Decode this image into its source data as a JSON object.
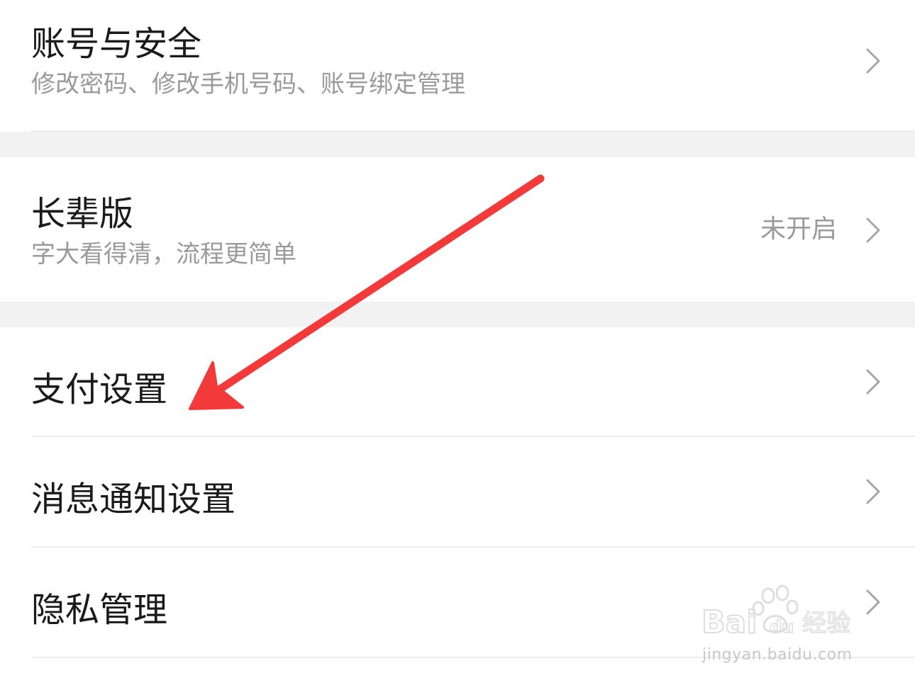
{
  "settings": {
    "account": {
      "title": "账号与安全",
      "subtitle": "修改密码、修改手机号码、账号绑定管理"
    },
    "elder_mode": {
      "title": "长辈版",
      "subtitle": "字大看得清，流程更简单",
      "status": "未开启"
    },
    "payment": {
      "title": "支付设置"
    },
    "notifications": {
      "title": "消息通知设置"
    },
    "privacy": {
      "title": "隐私管理"
    }
  },
  "annotation": {
    "arrow_color": "#f23a3a"
  },
  "watermark": {
    "brand": "Baidu经验",
    "url": "jingyan.baidu.com"
  }
}
